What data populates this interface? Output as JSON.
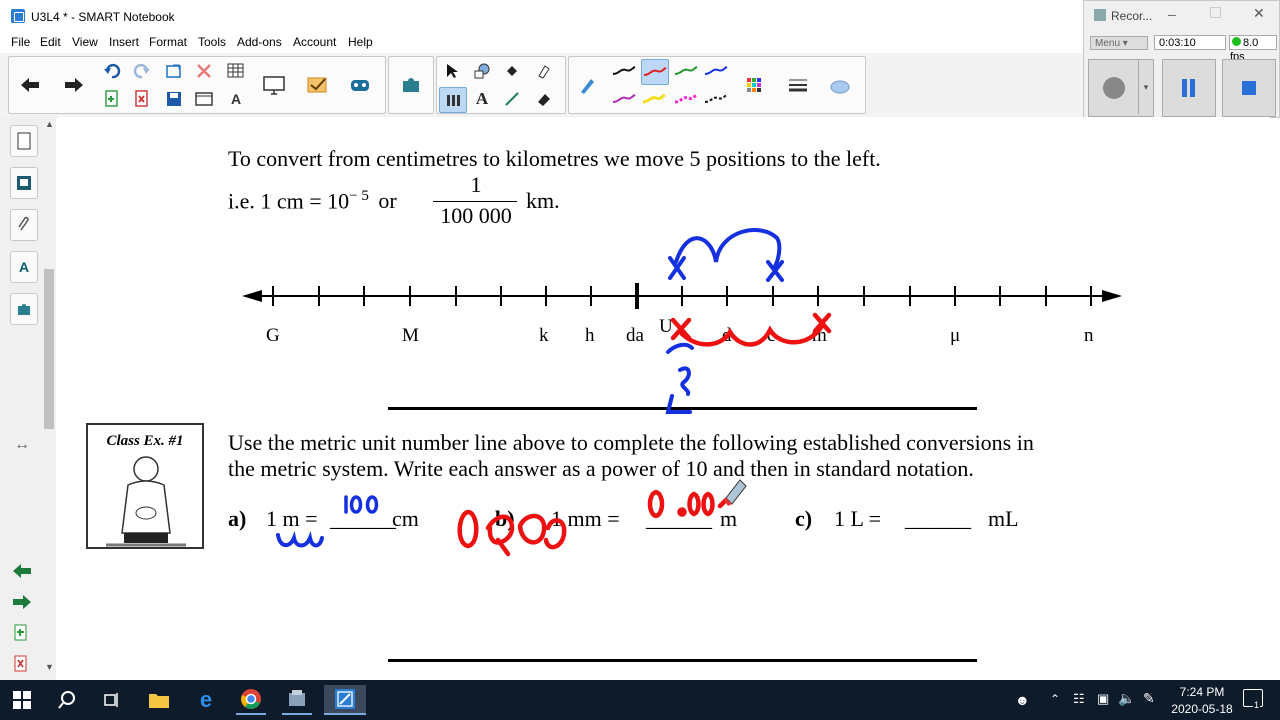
{
  "window": {
    "title": "U3L4 * - SMART Notebook",
    "menu": [
      "File",
      "Edit",
      "View",
      "Insert",
      "Format",
      "Tools",
      "Add-ons",
      "Account",
      "Help"
    ]
  },
  "recorder": {
    "title": "Recor...",
    "menu_label": "Menu",
    "timer": "0:03:10",
    "fps": "8.0 fps"
  },
  "page": {
    "intro_line1": "To convert from centimetres to kilometres we move 5 positions to the left.",
    "intro_line2_prefix": "i.e. 1 cm = 10",
    "intro_exponent": "− 5",
    "intro_or": "or",
    "fraction_numerator": "1",
    "fraction_denominator": "100 000",
    "intro_unit": "km.",
    "number_line_labels": [
      "G",
      "M",
      "k",
      "h",
      "da",
      "U",
      "d",
      "c",
      "m",
      "μ",
      "n"
    ],
    "class_ex_label": "Class Ex. #1",
    "instructions_line1": "Use the metric unit number line above to complete the following established conversions in",
    "instructions_line2": "the metric system.  Write each answer as a power of 10 and then in standard notation.",
    "q_a_label": "a)",
    "q_a_text": "1 m =",
    "q_a_blank": "______",
    "q_a_unit": "cm",
    "q_b_label": "b)",
    "q_b_text": "1 mm  =",
    "q_b_blank": "______",
    "q_b_unit": "m",
    "q_c_label": "c)",
    "q_c_text": "1 L  =",
    "q_c_blank": "______",
    "q_c_unit": "mL",
    "annotation_a": "100",
    "annotation_b": "0.00"
  },
  "colors": {
    "ink_blue": "#1530e0",
    "ink_red": "#ee1111",
    "taskbar": "#0d1b2a",
    "accent": "#2b7cd3"
  },
  "taskbar": {
    "time": "7:24 PM",
    "date": "2020-05-18",
    "notification_count": "1",
    "apps": [
      "windows-start",
      "search",
      "task-view",
      "file-explorer",
      "edge",
      "chrome",
      "media-app",
      "smart-notebook"
    ]
  }
}
